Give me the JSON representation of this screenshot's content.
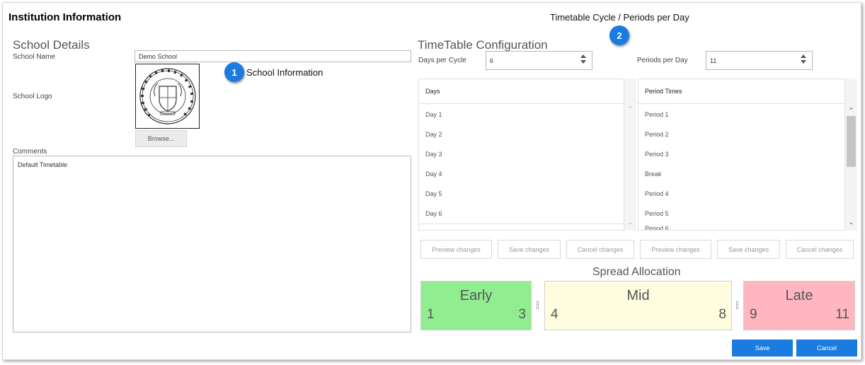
{
  "page": {
    "title": "Institution Information",
    "cycle_caption": "Timetable Cycle / Periods per Day"
  },
  "callouts": [
    {
      "number": "1",
      "label": "School Information"
    },
    {
      "number": "2"
    }
  ],
  "school_details": {
    "heading": "School Details",
    "school_name_label": "School Name",
    "school_name_value": "Demo School",
    "school_logo_label": "School Logo",
    "browse_label": "Browse...",
    "comments_label": "Comments",
    "comments_value": "Default Timetable"
  },
  "timetable": {
    "heading": "TimeTable Configuration",
    "days_per_cycle_label": "Days per Cycle",
    "days_per_cycle_value": "6",
    "periods_per_day_label": "Periods per Day",
    "periods_per_day_value": "11",
    "days_list": {
      "header": "Days",
      "items": [
        "Day 1",
        "Day 2",
        "Day 3",
        "Day 4",
        "Day 5",
        "Day 6"
      ]
    },
    "periods_list": {
      "header": "Period Times",
      "items": [
        "Period 1",
        "Period 2",
        "Period 3",
        "Break",
        "Period 4",
        "Period 5",
        "Period 6"
      ]
    },
    "buttons": {
      "preview": "Preview changes",
      "save": "Save changes",
      "cancel": "Cancel changes"
    }
  },
  "spread": {
    "title": "Spread Allocation",
    "segments": [
      {
        "name": "Early",
        "start": "1",
        "end": "3",
        "color": "#90ee90"
      },
      {
        "name": "Mid",
        "start": "4",
        "end": "8",
        "color": "#fffde0"
      },
      {
        "name": "Late",
        "start": "9",
        "end": "11",
        "color": "#ffb6c1"
      }
    ]
  },
  "footer": {
    "save": "Save",
    "cancel": "Cancel"
  },
  "colors": {
    "accent": "#1a7ce0"
  },
  "icons": {
    "spinner": "up-down-arrows-icon",
    "scroll": "chevron-icon",
    "grip": "drag-handle-icon"
  }
}
